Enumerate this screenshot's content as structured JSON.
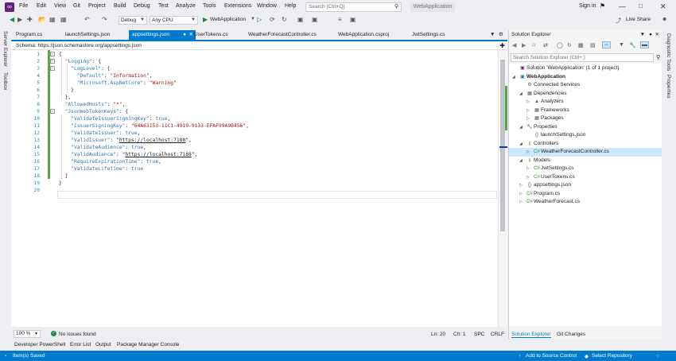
{
  "menu": {
    "items": [
      "File",
      "Edit",
      "View",
      "Git",
      "Project",
      "Build",
      "Debug",
      "Test",
      "Analyze",
      "Tools",
      "Extensions",
      "Window",
      "Help"
    ],
    "search_placeholder": "Search (Ctrl+Q)",
    "solution_name": "WebApplication",
    "sign_in": "Sign in",
    "live_share": "Live Share"
  },
  "toolbar": {
    "config": "Debug",
    "platform": "Any CPU",
    "run_target": "WebApplication"
  },
  "left_strip": [
    "Server Explorer",
    "Toolbox"
  ],
  "right_strip": [
    "Diagnostic Tools",
    "Properties"
  ],
  "tabs": [
    {
      "label": "Program.cs",
      "active": false
    },
    {
      "label": "launchSettings.json",
      "active": false
    },
    {
      "label": "appsettings.json",
      "active": true
    },
    {
      "label": "UserTokens.cs",
      "active": false
    },
    {
      "label": "WeatherForecastController.cs",
      "active": false
    },
    {
      "label": "WebApplication.csproj",
      "active": false
    },
    {
      "label": "JwtSettings.cs",
      "active": false
    }
  ],
  "schema": {
    "label": "Schema:",
    "url": "https://json.schemastore.org/appsettings.json"
  },
  "code_lines": [
    {
      "n": "1",
      "parts": [
        {
          "t": "{",
          "c": "p"
        }
      ]
    },
    {
      "n": "2",
      "parts": [
        {
          "t": "  \"Logging\"",
          "c": "k"
        },
        {
          "t": ": {",
          "c": "p"
        }
      ]
    },
    {
      "n": "3",
      "parts": [
        {
          "t": "    \"LogLevel\"",
          "c": "k"
        },
        {
          "t": ": {",
          "c": "p"
        }
      ]
    },
    {
      "n": "4",
      "parts": [
        {
          "t": "      \"Default\"",
          "c": "k"
        },
        {
          "t": ": ",
          "c": "p"
        },
        {
          "t": "\"Information\"",
          "c": "s"
        },
        {
          "t": ",",
          "c": "p"
        }
      ]
    },
    {
      "n": "5",
      "parts": [
        {
          "t": "      \"Microsoft.AspNetCore\"",
          "c": "k"
        },
        {
          "t": ": ",
          "c": "p"
        },
        {
          "t": "\"Warning\"",
          "c": "s"
        }
      ]
    },
    {
      "n": "6",
      "parts": [
        {
          "t": "    }",
          "c": "p"
        }
      ]
    },
    {
      "n": "7",
      "parts": [
        {
          "t": "  },",
          "c": "p"
        }
      ]
    },
    {
      "n": "8",
      "parts": [
        {
          "t": "  \"AllowedHosts\"",
          "c": "k"
        },
        {
          "t": ": ",
          "c": "p"
        },
        {
          "t": "\"*\"",
          "c": "s"
        },
        {
          "t": ",",
          "c": "p"
        }
      ]
    },
    {
      "n": "9",
      "parts": [
        {
          "t": "  \"JsonWebTokenKeys\"",
          "c": "k"
        },
        {
          "t": ": {",
          "c": "p"
        }
      ]
    },
    {
      "n": "10",
      "parts": [
        {
          "t": "    \"ValidateIssuerSigningKey\"",
          "c": "k"
        },
        {
          "t": ": ",
          "c": "p"
        },
        {
          "t": "true",
          "c": "k"
        },
        {
          "t": ",",
          "c": "p"
        }
      ]
    },
    {
      "n": "11",
      "parts": [
        {
          "t": "    \"IssuerSigningKey\"",
          "c": "k"
        },
        {
          "t": ": ",
          "c": "p"
        },
        {
          "t": "\"64A63153-11C1-4919-9133-EFAF99A9B456\"",
          "c": "s"
        },
        {
          "t": ",",
          "c": "p"
        }
      ]
    },
    {
      "n": "12",
      "parts": [
        {
          "t": "    \"ValidateIssuer\"",
          "c": "k"
        },
        {
          "t": ": ",
          "c": "p"
        },
        {
          "t": "true",
          "c": "k"
        },
        {
          "t": ",",
          "c": "p"
        }
      ]
    },
    {
      "n": "13",
      "parts": [
        {
          "t": "    \"ValidIssuer\"",
          "c": "k"
        },
        {
          "t": ": \"",
          "c": "p"
        },
        {
          "t": "https://localhost:7188",
          "c": "u"
        },
        {
          "t": "\",",
          "c": "p"
        }
      ]
    },
    {
      "n": "14",
      "parts": [
        {
          "t": "    \"ValidateAudience\"",
          "c": "k"
        },
        {
          "t": ": ",
          "c": "p"
        },
        {
          "t": "true",
          "c": "k"
        },
        {
          "t": ",",
          "c": "p"
        }
      ]
    },
    {
      "n": "15",
      "parts": [
        {
          "t": "    \"ValidAudience\"",
          "c": "k"
        },
        {
          "t": ": \"",
          "c": "p"
        },
        {
          "t": "https://localhost:7188",
          "c": "u"
        },
        {
          "t": "\",",
          "c": "p"
        }
      ]
    },
    {
      "n": "16",
      "parts": [
        {
          "t": "    \"RequireExpirationTime\"",
          "c": "k"
        },
        {
          "t": ": ",
          "c": "p"
        },
        {
          "t": "true",
          "c": "k"
        },
        {
          "t": ",",
          "c": "p"
        }
      ]
    },
    {
      "n": "17",
      "parts": [
        {
          "t": "    \"ValidateLifetime\"",
          "c": "k"
        },
        {
          "t": ": ",
          "c": "p"
        },
        {
          "t": "true",
          "c": "k"
        }
      ]
    },
    {
      "n": "18",
      "parts": [
        {
          "t": "  }",
          "c": "p"
        }
      ]
    },
    {
      "n": "19",
      "parts": [
        {
          "t": "}",
          "c": "p"
        }
      ]
    },
    {
      "n": "20",
      "parts": []
    }
  ],
  "editor_status": {
    "zoom": "100 %",
    "issues": "No issues found",
    "line": "Ln: 20",
    "col": "Ch: 1",
    "spc": "SPC",
    "crlf": "CRLF"
  },
  "bottom_tabs": [
    "Developer PowerShell",
    "Error List",
    "Output",
    "Package Manager Console"
  ],
  "statusbar": {
    "left": "Item(s) Saved",
    "source_control": "Add to Source Control",
    "repo": "Select Repository"
  },
  "solution_explorer": {
    "title": "Solution Explorer",
    "search_placeholder": "Search Solution Explorer (Ctrl+;)",
    "items": [
      {
        "label": "Solution 'WebApplication' (1 of 1 project)",
        "depth": 0,
        "twisty": "",
        "icon": "solution-icon"
      },
      {
        "label": "WebApplication",
        "depth": 0,
        "twisty": "open",
        "icon": "project-icon",
        "bold": true
      },
      {
        "label": "Connected Services",
        "depth": 1,
        "twisty": "",
        "icon": "connected-services-icon"
      },
      {
        "label": "Dependencies",
        "depth": 1,
        "twisty": "open",
        "icon": "dependencies-icon"
      },
      {
        "label": "Analyzers",
        "depth": 2,
        "twisty": "closed",
        "icon": "analyzers-icon"
      },
      {
        "label": "Frameworks",
        "depth": 2,
        "twisty": "closed",
        "icon": "frameworks-icon"
      },
      {
        "label": "Packages",
        "depth": 2,
        "twisty": "closed",
        "icon": "packages-icon"
      },
      {
        "label": "Properties",
        "depth": 1,
        "twisty": "open",
        "icon": "properties-icon"
      },
      {
        "label": "launchSettings.json",
        "depth": 2,
        "twisty": "",
        "icon": "json-file-icon"
      },
      {
        "label": "Controllers",
        "depth": 1,
        "twisty": "open",
        "icon": "folder-icon"
      },
      {
        "label": "WeatherForecastController.cs",
        "depth": 2,
        "twisty": "closed",
        "icon": "csharp-file-icon",
        "selected": true
      },
      {
        "label": "Models",
        "depth": 1,
        "twisty": "open",
        "icon": "folder-icon"
      },
      {
        "label": "JwtSettings.cs",
        "depth": 2,
        "twisty": "closed",
        "icon": "csharp-file-icon"
      },
      {
        "label": "UserTokens.cs",
        "depth": 2,
        "twisty": "closed",
        "icon": "csharp-file-icon"
      },
      {
        "label": "appsettings.json",
        "depth": 1,
        "twisty": "closed",
        "icon": "json-file-icon"
      },
      {
        "label": "Program.cs",
        "depth": 1,
        "twisty": "closed",
        "icon": "csharp-file-icon"
      },
      {
        "label": "WeatherForecast.cs",
        "depth": 1,
        "twisty": "closed",
        "icon": "csharp-file-icon"
      }
    ],
    "bottom_tabs": [
      "Solution Explorer",
      "Git Changes"
    ]
  },
  "colors": {
    "accent": "#007acc",
    "keyword": "#2e75b6",
    "string": "#a31515",
    "line_number": "#2b91af",
    "change_bar": "#57a64a"
  }
}
